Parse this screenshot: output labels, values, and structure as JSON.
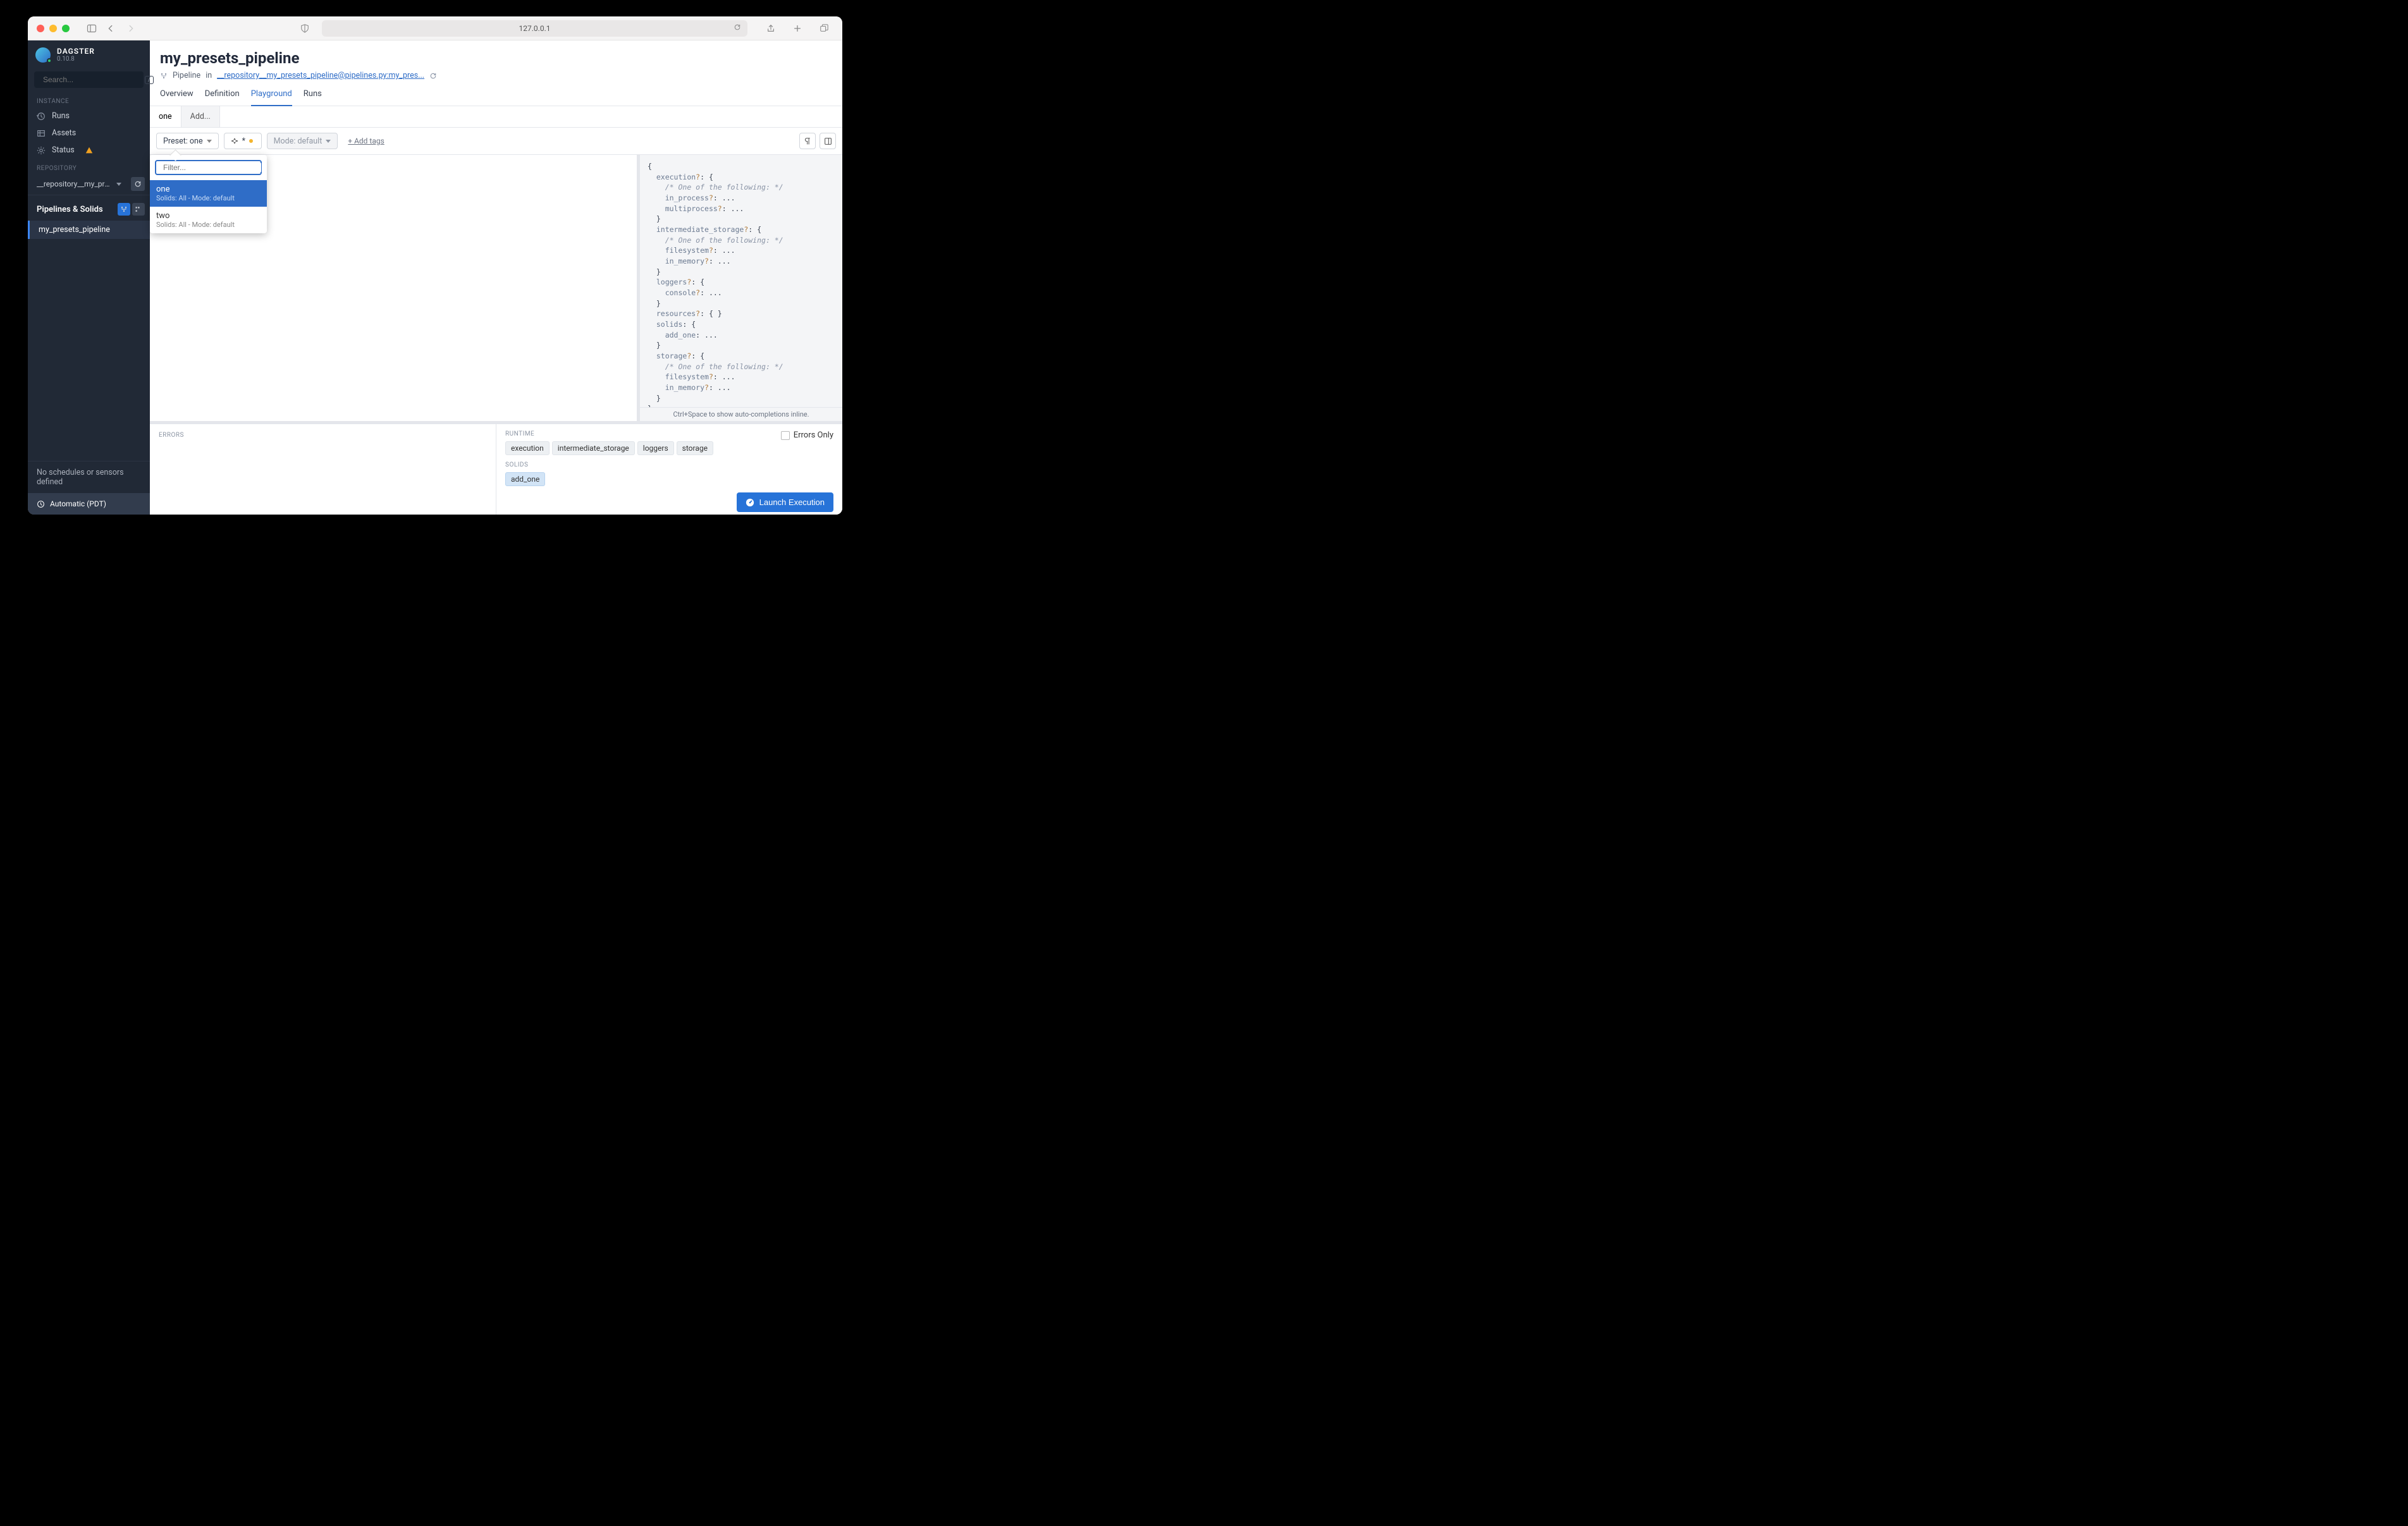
{
  "browser": {
    "url": "127.0.0.1"
  },
  "sidebar": {
    "brand_name": "DAGSTER",
    "version": "0.10.8",
    "search_placeholder": "Search...",
    "slash_hint": "/",
    "section_instance": "INSTANCE",
    "items": {
      "runs": "Runs",
      "assets": "Assets",
      "status": "Status"
    },
    "section_repository": "REPOSITORY",
    "repository_name": "__repository__my_pre...",
    "pipelines_title": "Pipelines & Solids",
    "pipeline_item": "my_presets_pipeline",
    "no_schedules": "No schedules or sensors defined",
    "timezone": "Automatic (PDT)"
  },
  "header": {
    "title": "my_presets_pipeline",
    "type_label": "Pipeline",
    "in_label": "in",
    "repo_path": "__repository__my_presets_pipeline@pipelines.py:my_pres..."
  },
  "tabs": {
    "overview": "Overview",
    "definition": "Definition",
    "playground": "Playground",
    "runs": "Runs"
  },
  "subtabs": {
    "one": "one",
    "add": "Add..."
  },
  "toolbar": {
    "preset_label": "Preset: one",
    "solid_selector_value": "*",
    "mode_label": "Mode: default",
    "add_tags": "+ Add tags"
  },
  "preset_popup": {
    "filter_placeholder": "Filter...",
    "items": [
      {
        "name": "one",
        "sub": "Solids: All - Mode: default"
      },
      {
        "name": "two",
        "sub": "Solids: All - Mode: default"
      }
    ]
  },
  "yaml": {
    "hint": "Ctrl+Space to show auto-completions inline.",
    "lines": [
      {
        "i": 0,
        "t": "{",
        "c": "p"
      },
      {
        "i": 1,
        "t": "execution?: {",
        "c": "kq"
      },
      {
        "i": 2,
        "t": "/* One of the following: */",
        "c": "c"
      },
      {
        "i": 2,
        "t": "in_process?: ...",
        "c": "kq"
      },
      {
        "i": 2,
        "t": "multiprocess?: ...",
        "c": "kq"
      },
      {
        "i": 1,
        "t": "}",
        "c": "p"
      },
      {
        "i": 1,
        "t": "intermediate_storage?: {",
        "c": "kq"
      },
      {
        "i": 2,
        "t": "/* One of the following: */",
        "c": "c"
      },
      {
        "i": 2,
        "t": "filesystem?: ...",
        "c": "kq"
      },
      {
        "i": 2,
        "t": "in_memory?: ...",
        "c": "kq"
      },
      {
        "i": 1,
        "t": "}",
        "c": "p"
      },
      {
        "i": 1,
        "t": "loggers?: {",
        "c": "kq"
      },
      {
        "i": 2,
        "t": "console?: ...",
        "c": "kq"
      },
      {
        "i": 1,
        "t": "}",
        "c": "p"
      },
      {
        "i": 1,
        "t": "resources?: { }",
        "c": "kq"
      },
      {
        "i": 1,
        "t": "solids: {",
        "c": "kq"
      },
      {
        "i": 2,
        "t": "add_one: ...",
        "c": "kq"
      },
      {
        "i": 1,
        "t": "}",
        "c": "p"
      },
      {
        "i": 1,
        "t": "storage?: {",
        "c": "kq"
      },
      {
        "i": 2,
        "t": "/* One of the following: */",
        "c": "c"
      },
      {
        "i": 2,
        "t": "filesystem?: ...",
        "c": "kq"
      },
      {
        "i": 2,
        "t": "in_memory?: ...",
        "c": "kq"
      },
      {
        "i": 1,
        "t": "}",
        "c": "p"
      },
      {
        "i": 0,
        "t": "}",
        "c": "p"
      }
    ]
  },
  "bottom": {
    "errors_label": "ERRORS",
    "runtime_label": "RUNTIME",
    "runtime_tags": [
      "execution",
      "intermediate_storage",
      "loggers",
      "storage"
    ],
    "solids_label": "SOLIDS",
    "solids_tags": [
      "add_one"
    ],
    "errors_only_label": "Errors Only",
    "launch_label": "Launch Execution"
  }
}
